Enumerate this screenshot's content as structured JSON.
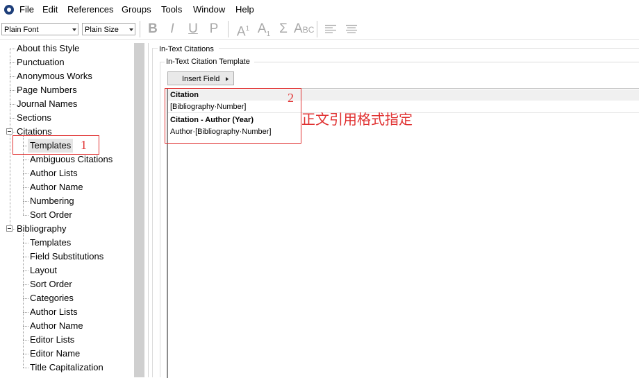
{
  "menu": [
    "File",
    "Edit",
    "References",
    "Groups",
    "Tools",
    "Window",
    "Help"
  ],
  "toolbar": {
    "font_combo": "Plain Font",
    "size_combo": "Plain Size",
    "bold": "B",
    "italic": "I",
    "underline": "U",
    "plain": "P",
    "superscript": "A",
    "superscript_mark": "1",
    "subscript": "A",
    "subscript_mark": "1",
    "symbol": "Σ",
    "smallcaps": "A",
    "smallcaps_small": "BC"
  },
  "tree": {
    "top_items": [
      "About this Style",
      "Punctuation",
      "Anonymous Works",
      "Page Numbers",
      "Journal Names",
      "Sections"
    ],
    "citations": {
      "label": "Citations",
      "children": [
        "Templates",
        "Ambiguous Citations",
        "Author Lists",
        "Author Name",
        "Numbering",
        "Sort Order"
      ]
    },
    "bibliography": {
      "label": "Bibliography",
      "children": [
        "Templates",
        "Field Substitutions",
        "Layout",
        "Sort Order",
        "Categories",
        "Author Lists",
        "Author Name",
        "Editor Lists",
        "Editor Name",
        "Title Capitalization"
      ]
    }
  },
  "panel": {
    "section_title": "In-Text Citations",
    "group_title": "In-Text Citation Template",
    "insert_field_label": "Insert Field"
  },
  "templates": [
    {
      "name": "Citation",
      "value": "[Bibliography·Number]"
    },
    {
      "name": "Citation - Author (Year)",
      "value": "Author·[Bibliography·Number]"
    }
  ],
  "annotations": {
    "marker1": "1",
    "marker2": "2",
    "note": "正文引用格式指定",
    "color": "#e03131"
  }
}
